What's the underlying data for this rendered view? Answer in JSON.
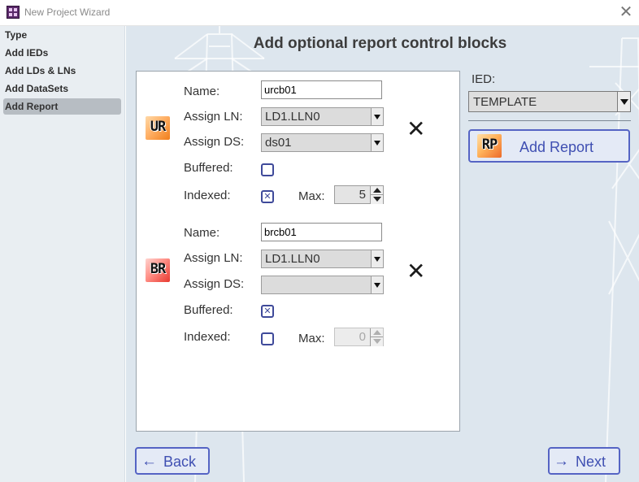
{
  "window": {
    "title": "New Project Wizard",
    "app_icon": "wizard-app-icon",
    "close_glyph": "✕"
  },
  "sidebar": {
    "items": [
      {
        "label": "Type"
      },
      {
        "label": "Add IEDs"
      },
      {
        "label": "Add LDs & LNs"
      },
      {
        "label": "Add DataSets"
      },
      {
        "label": "Add Report",
        "active": true
      }
    ]
  },
  "main": {
    "heading": "Add optional report control blocks",
    "labels": {
      "name": "Name:",
      "assign_ln": "Assign LN:",
      "assign_ds": "Assign DS:",
      "buffered": "Buffered:",
      "indexed": "Indexed:",
      "max": "Max:"
    },
    "report_blocks": [
      {
        "badge": "UR",
        "badge_icon": "unbuffered-report-icon",
        "name": "urcb01",
        "assign_ln": "LD1.LLN0",
        "assign_ds": "ds01",
        "buffered": false,
        "indexed": true,
        "max": "5",
        "max_enabled": true,
        "delete_glyph": "✕"
      },
      {
        "badge": "BR",
        "badge_icon": "buffered-report-icon",
        "name": "brcb01",
        "assign_ln": "LD1.LLN0",
        "assign_ds": "",
        "buffered": true,
        "indexed": false,
        "max": "0",
        "max_enabled": false,
        "delete_glyph": "✕"
      }
    ],
    "ied": {
      "label": "IED:",
      "value": "TEMPLATE"
    },
    "add_report": {
      "badge": "RP",
      "label": "Add Report"
    },
    "nav": {
      "back": "Back",
      "next": "Next",
      "back_arrow": "←",
      "next_arrow": "→"
    }
  },
  "colors": {
    "accent": "#3f4fb2",
    "accent_border": "#5564c4",
    "sidebar_bg": "#e9eef2",
    "main_bg": "#dde6ee",
    "active_item": "#b7bdc3"
  },
  "icons": {
    "checkbox_checked_glyph": "✕",
    "tower_background": "power-tower-icon"
  }
}
